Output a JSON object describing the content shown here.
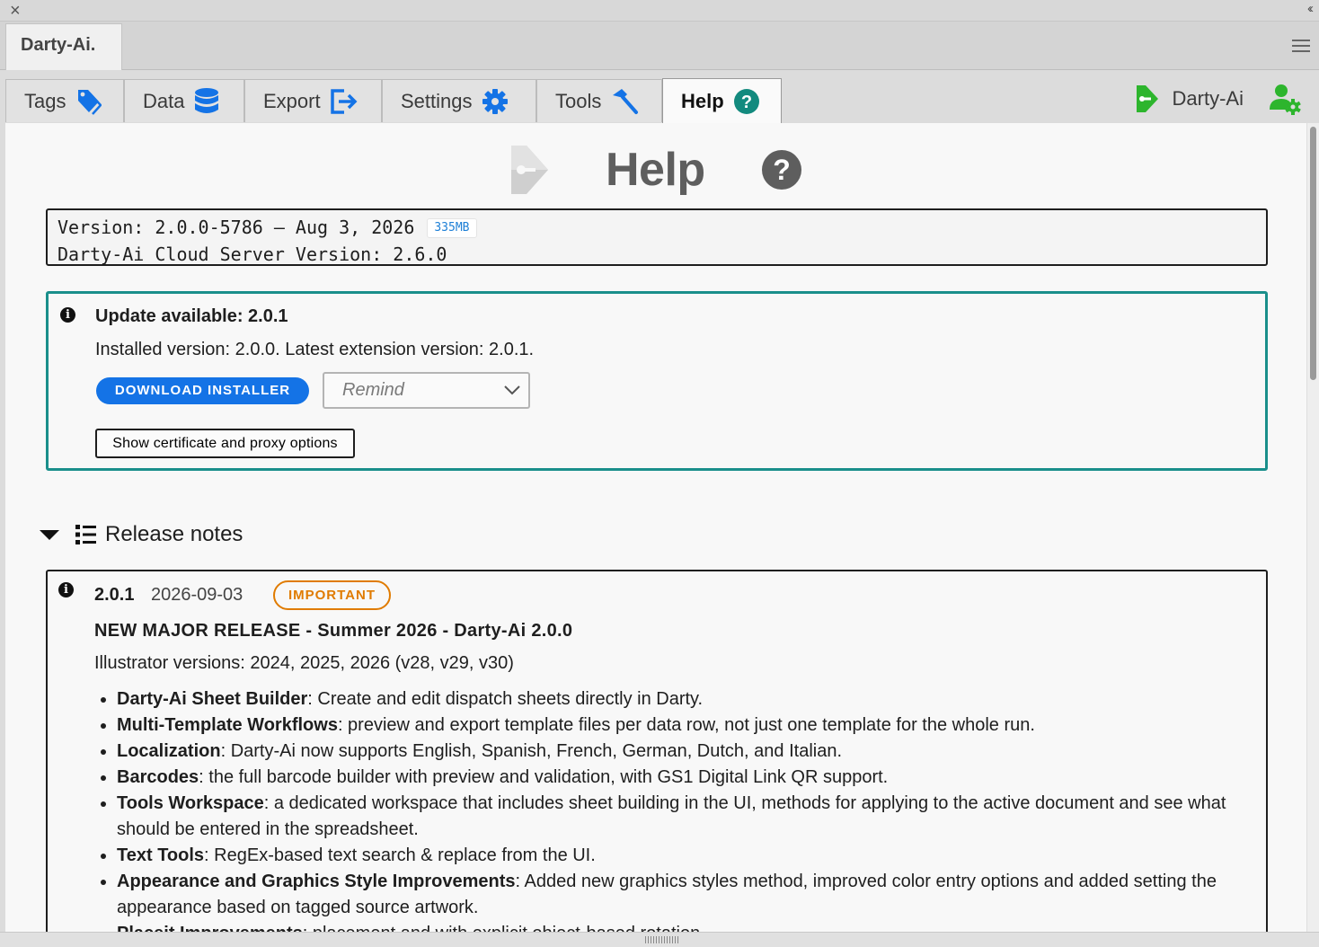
{
  "window": {
    "panel_tab": "Darty-Ai."
  },
  "tabs": [
    {
      "label": "Tags",
      "icon": "tag-icon"
    },
    {
      "label": "Data",
      "icon": "database-icon"
    },
    {
      "label": "Export",
      "icon": "export-icon"
    },
    {
      "label": "Settings",
      "icon": "gear-icon"
    },
    {
      "label": "Tools",
      "icon": "hammer-icon"
    },
    {
      "label": "Help",
      "icon": "help-icon",
      "active": true
    }
  ],
  "user": {
    "name": "Darty-Ai"
  },
  "help": {
    "title": "Help",
    "version_line": "Version: 2.0.0-5786 – Aug 3, 2026",
    "size": "335MB",
    "server_line": "Darty-Ai Cloud Server Version: 2.6.0"
  },
  "update": {
    "title": "Update available: 2.0.1",
    "subtitle": "Installed version: 2.0.0. Latest extension version: 2.0.1.",
    "download_label": "DOWNLOAD INSTALLER",
    "remind_value": "Remind",
    "cert_label": "Show certificate and proxy options"
  },
  "release_notes": {
    "title": "Release notes",
    "entry": {
      "version": "2.0.1",
      "date": "2026-09-03",
      "badge": "IMPORTANT",
      "headline": "NEW MAJOR RELEASE - Summer 2026 - Darty-Ai 2.0.0",
      "versions": "Illustrator versions: 2024, 2025, 2026 (v28, v29, v30)",
      "items": [
        {
          "bold": "Darty-Ai Sheet Builder",
          "text": ": Create and edit dispatch sheets directly in Darty."
        },
        {
          "bold": "Multi-Template Workflows",
          "text": ": preview and export template files per data row, not just one template for the whole run."
        },
        {
          "bold": "Localization",
          "text": ": Darty-Ai now supports English, Spanish, French, German, Dutch, and Italian."
        },
        {
          "bold": "Barcodes",
          "text": ": the full barcode builder with preview and validation, with GS1 Digital Link QR support."
        },
        {
          "bold": "Tools Workspace",
          "text": ": a dedicated workspace that includes sheet building in the UI, methods for applying to the active document and see what should be entered in the spreadsheet."
        },
        {
          "bold": "Text Tools",
          "text": ": RegEx-based text search & replace from the UI."
        },
        {
          "bold": "Appearance and Graphics Style Improvements",
          "text": ": Added new graphics styles method, improved color entry options and added setting the appearance based on tagged source artwork."
        },
        {
          "bold": "Placeit Improvements",
          "text": ": placement and with explicit object-based rotation."
        }
      ]
    }
  },
  "colors": {
    "accent_blue": "#1473e6",
    "teal_border": "#1a8f8b",
    "important_orange": "#e07b00",
    "brand_green": "#2db52d",
    "icon_blue": "#1473e6"
  }
}
